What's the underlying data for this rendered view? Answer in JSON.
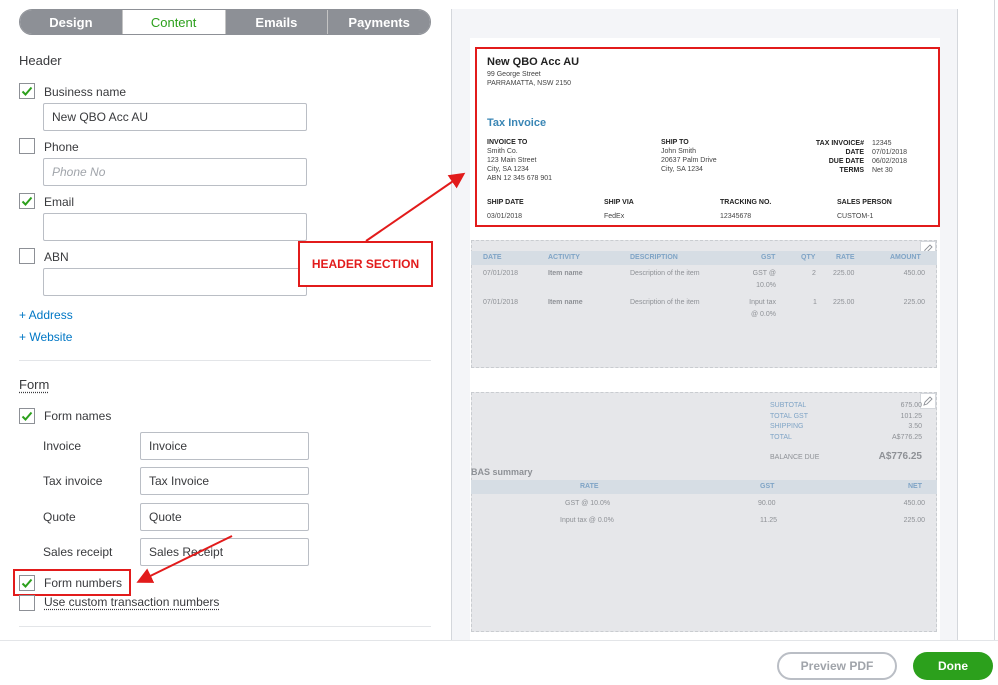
{
  "tabs": [
    {
      "label": "Design"
    },
    {
      "label": "Content"
    },
    {
      "label": "Emails"
    },
    {
      "label": "Payments"
    }
  ],
  "header_section": {
    "title": "Header",
    "business_name": {
      "label": "Business name",
      "value": "New QBO Acc AU",
      "checked": true
    },
    "phone": {
      "label": "Phone",
      "placeholder": "Phone No",
      "checked": false
    },
    "email": {
      "label": "Email",
      "value": "",
      "checked": true
    },
    "abn": {
      "label": "ABN",
      "value": "",
      "checked": false
    },
    "add_address": "+ Address",
    "add_website": "+ Website"
  },
  "form_section": {
    "title": "Form",
    "form_names": {
      "label": "Form names",
      "checked": true
    },
    "rows": [
      {
        "label": "Invoice",
        "value": "Invoice"
      },
      {
        "label": "Tax invoice",
        "value": "Tax Invoice"
      },
      {
        "label": "Quote",
        "value": "Quote"
      },
      {
        "label": "Sales receipt",
        "value": "Sales Receipt"
      }
    ],
    "form_numbers": {
      "label": "Form numbers",
      "checked": true
    },
    "custom_numbers": {
      "label": "Use custom transaction numbers",
      "checked": false
    }
  },
  "annotation": {
    "callout": "HEADER SECTION",
    "color": "#e21b1b"
  },
  "invoice": {
    "company": "New QBO Acc AU",
    "address": "99 George Street\nPARRAMATTA, NSW 2150",
    "title": "Tax Invoice",
    "invoice_to_label": "INVOICE TO",
    "invoice_to": "Smith Co.\n123 Main Street\nCity, SA 1234\nABN 12 345 678 901",
    "ship_to_label": "SHIP TO",
    "ship_to": "John Smith\n20637 Palm Drive\nCity, SA 1234",
    "meta_labels": "TAX INVOICE#\nDATE\nDUE DATE\nTERMS",
    "meta_values": "12345\n07/01/2018\n06/02/2018\nNet 30",
    "ship_date_label": "SHIP DATE",
    "ship_date": "03/01/2018",
    "ship_via_label": "SHIP VIA",
    "ship_via": "FedEx",
    "tracking_label": "TRACKING NO.",
    "tracking": "12345678",
    "sales_person_label": "SALES PERSON",
    "sales_person": "CUSTOM-1",
    "columns": [
      "DATE",
      "ACTIVITY",
      "DESCRIPTION",
      "GST",
      "QTY",
      "RATE",
      "AMOUNT"
    ],
    "lines": [
      {
        "date": "07/01/2018",
        "activity": "Item name",
        "description": "Description of the item",
        "gst": "GST @\n10.0%",
        "qty": "2",
        "rate": "225.00",
        "amount": "450.00"
      },
      {
        "date": "07/01/2018",
        "activity": "Item name",
        "description": "Description of the item",
        "gst": "Input tax\n@ 0.0%",
        "qty": "1",
        "rate": "225.00",
        "amount": "225.00"
      }
    ],
    "totals_labels": "SUBTOTAL\nTOTAL GST\nSHIPPING\nTOTAL",
    "totals_values": "675.00\n101.25\n3.50\nA$776.25",
    "balance_due_label": "BALANCE DUE",
    "balance_due": "A$776.25",
    "bas_title": "BAS summary",
    "bas_columns": [
      "RATE",
      "GST",
      "NET"
    ],
    "bas_rows": [
      {
        "rate": "GST @ 10.0%",
        "gst": "90.00",
        "net": "450.00"
      },
      {
        "rate": "Input tax @ 0.0%",
        "gst": "11.25",
        "net": "225.00"
      }
    ]
  },
  "footer": {
    "preview_label": "Preview PDF",
    "done_label": "Done"
  },
  "colors": {
    "accent": "#2ca01c",
    "link": "#0077c5",
    "annotation": "#e21b1b",
    "invoice_title": "#3a86b5"
  }
}
